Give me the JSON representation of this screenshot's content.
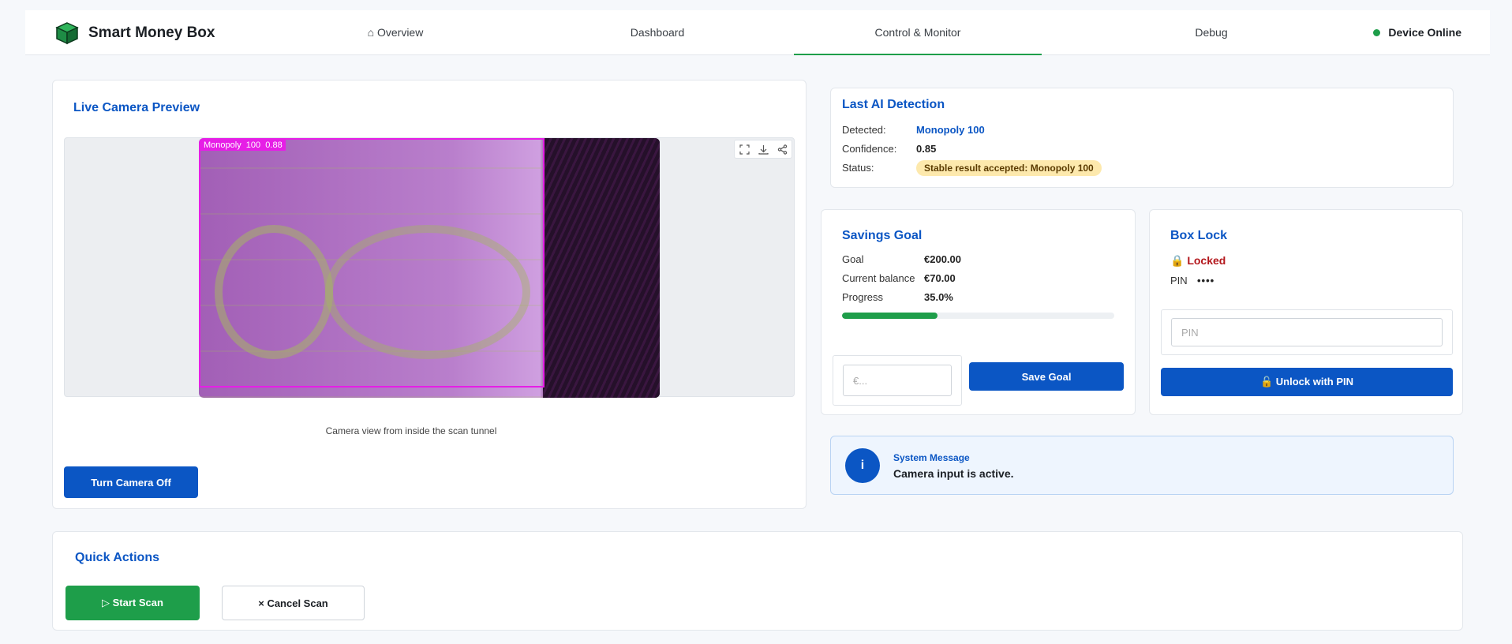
{
  "app": {
    "name": "Smart Money Box",
    "status": "Device Online",
    "status_color": "#1e9e4a",
    "accent": "#0b56c4"
  },
  "nav": {
    "overview": "⌂ Overview",
    "dashboard": "Dashboard",
    "control": "Control & Monitor",
    "debug": "Debug",
    "active": "Control & Monitor"
  },
  "camera": {
    "title": "Live Camera Preview",
    "detection_label": "Monopoly  100  0.88",
    "caption": "Camera view from inside the scan tunnel",
    "toggle_label": "Turn Camera Off",
    "tools": [
      "fullscreen-icon",
      "download-icon",
      "share-icon"
    ]
  },
  "detection": {
    "title": "Last AI Detection",
    "detected_label": "Detected:",
    "detected_value": "Monopoly 100",
    "confidence_label": "Confidence:",
    "confidence_value": "0.85",
    "status_label": "Status:",
    "status_value": "Stable result accepted: Monopoly 100"
  },
  "savings": {
    "title": "Savings Goal",
    "goal_label": "Goal",
    "goal_value": "€200.00",
    "balance_label": "Current balance",
    "balance_value": "€70.00",
    "progress_label": "Progress",
    "progress_value": "35.0%",
    "progress_fraction": 0.35,
    "input_placeholder": "€...",
    "save_label": "Save Goal"
  },
  "lock": {
    "title": "Box Lock",
    "state": "🔒 Locked",
    "pin_label": "PIN",
    "pin_mask": "••••",
    "pin_placeholder": "PIN",
    "unlock_label": "🔓 Unlock with PIN"
  },
  "message": {
    "icon": "i",
    "title": "System Message",
    "text": "Camera input is active."
  },
  "quick_actions": {
    "title": "Quick Actions",
    "start_label": "▷ Start Scan",
    "cancel_label": "× Cancel Scan"
  }
}
